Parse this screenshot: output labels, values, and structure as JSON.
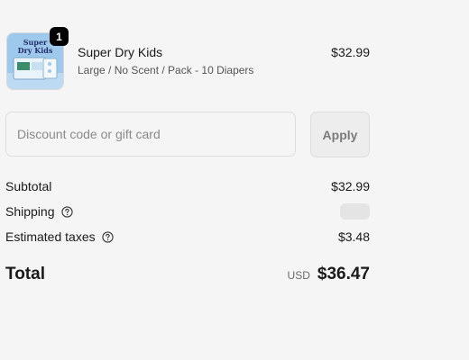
{
  "product": {
    "quantity": "1",
    "name": "Super Dry Kids",
    "variant": "Large / No Scent / Pack - 10 Diapers",
    "price": "$32.99",
    "image_text": "Super Dry Kids",
    "image_icon": "diaper-pack-image"
  },
  "discount": {
    "placeholder": "Discount code or gift card",
    "value": "",
    "apply_label": "Apply"
  },
  "summary": {
    "subtotal_label": "Subtotal",
    "subtotal_value": "$32.99",
    "shipping_label": "Shipping",
    "shipping_icon": "question-circle-icon",
    "taxes_label": "Estimated taxes",
    "taxes_icon": "question-circle-icon",
    "taxes_value": "$3.48",
    "total_label": "Total",
    "currency": "USD",
    "total_value": "$36.47"
  },
  "colors": {
    "background": "#f5f5f5",
    "text": "#1a1a1a",
    "muted_text": "#555555",
    "badge": "#000000",
    "apply_button_bg": "#ededed"
  }
}
